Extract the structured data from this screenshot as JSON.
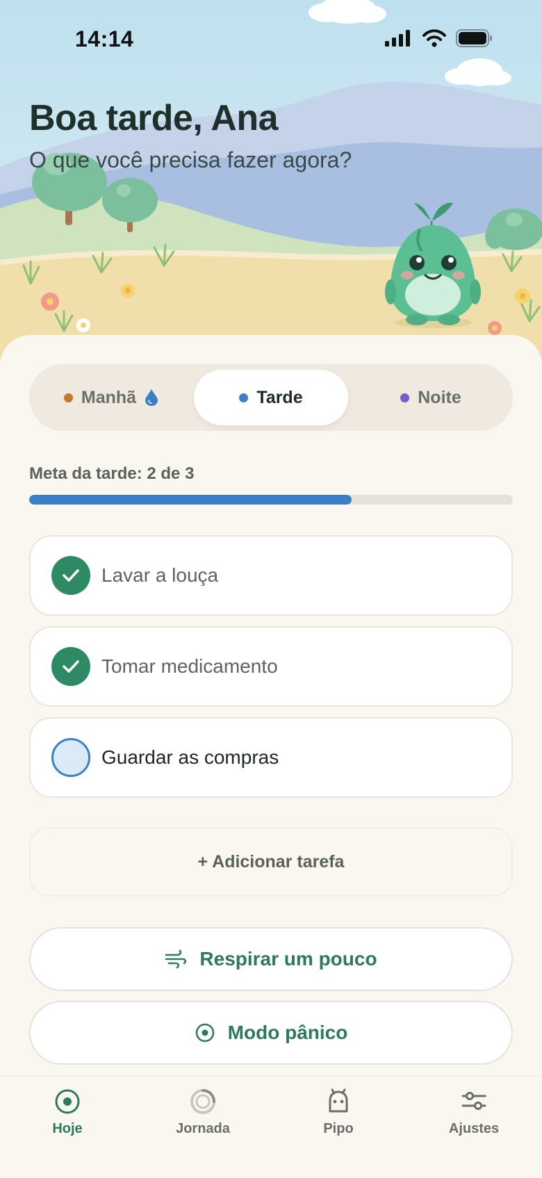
{
  "status_bar": {
    "time": "14:14"
  },
  "header": {
    "greeting": "Boa tarde, Ana",
    "subtitle": "O que você precisa fazer agora?"
  },
  "period_selector": {
    "options": [
      {
        "label": "Manhã",
        "dot_color": "#c07a2a",
        "icon": "water-drop-icon",
        "active": false
      },
      {
        "label": "Tarde",
        "dot_color": "#3b7fc4",
        "active": true
      },
      {
        "label": "Noite",
        "dot_color": "#7a5bc8",
        "active": false
      }
    ]
  },
  "goal": {
    "label": "Meta da tarde: 2 de 3",
    "completed": 2,
    "total": 3,
    "progress_percent": 66.7,
    "color": "#3b7fc4"
  },
  "tasks": [
    {
      "label": "Lavar a louça",
      "done": true
    },
    {
      "label": "Tomar medicamento",
      "done": true
    },
    {
      "label": "Guardar as compras",
      "done": false
    }
  ],
  "add_task_label": "+ Adicionar tarefa",
  "actions": {
    "breathe": {
      "label": "Respirar um pouco",
      "icon": "wind-icon"
    },
    "panic": {
      "label": "Modo pânico",
      "icon": "target-icon"
    }
  },
  "tabbar": {
    "items": [
      {
        "label": "Hoje",
        "icon": "today-icon",
        "active": true
      },
      {
        "label": "Jornada",
        "icon": "journey-icon",
        "active": false
      },
      {
        "label": "Pipo",
        "icon": "pipo-icon",
        "active": false
      },
      {
        "label": "Ajustes",
        "icon": "sliders-icon",
        "active": false
      }
    ]
  },
  "colors": {
    "primary_green": "#2c7a5b",
    "accent_blue": "#3b7fc4",
    "background": "#faf7f1"
  }
}
